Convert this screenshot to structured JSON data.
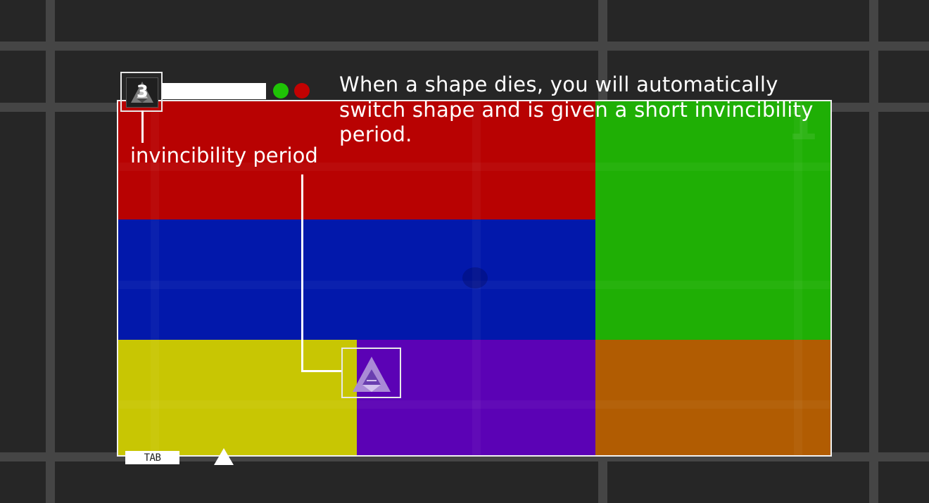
{
  "colors": {
    "background": "#262626",
    "grid_lines": "#454545",
    "zone_red": "#b80202",
    "zone_blue": "#0218ab",
    "zone_green": "#1faf05",
    "zone_yellow": "#c8c603",
    "zone_purple": "#5b02b5",
    "zone_orange": "#b15c02"
  },
  "hud": {
    "lives": "3",
    "player_icon": "triangle-icon",
    "status_dots": [
      "green",
      "red"
    ],
    "tab_key_label": "TAB",
    "current_shape_icon": "triangle-icon"
  },
  "arena": {
    "zone_number": "1"
  },
  "tutorial": {
    "instruction": "When a shape dies, you will automatically switch shape and is given a short invincibility period.",
    "callout_label": "invincibility period"
  }
}
